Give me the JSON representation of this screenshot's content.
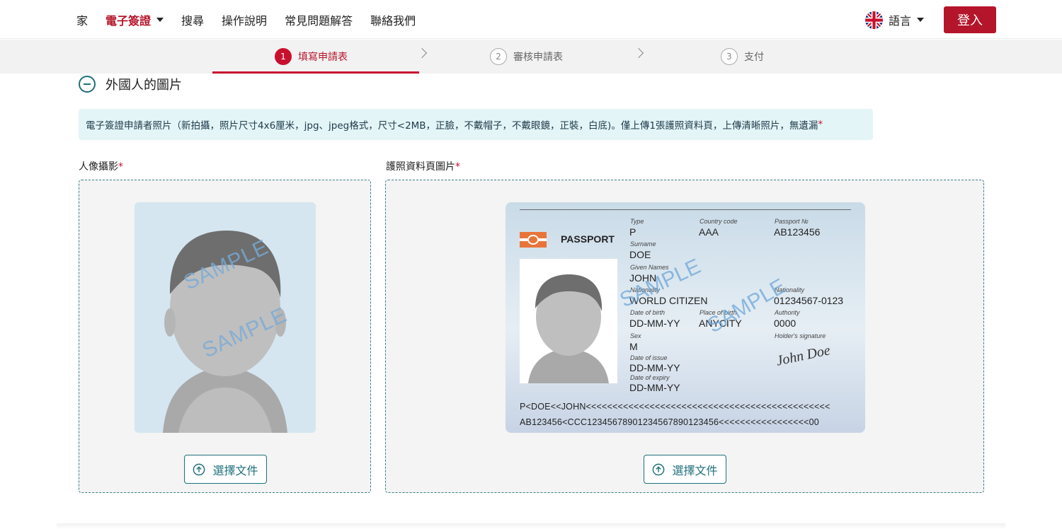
{
  "nav": {
    "items": [
      {
        "label": "家"
      },
      {
        "label": "電子簽證"
      },
      {
        "label": "搜尋"
      },
      {
        "label": "操作說明"
      },
      {
        "label": "常見問題解答"
      },
      {
        "label": "聯絡我們"
      }
    ],
    "language_label": "語言",
    "login_label": "登入"
  },
  "steps": [
    {
      "num": "1",
      "label": "填寫申請表"
    },
    {
      "num": "2",
      "label": "審核申請表"
    },
    {
      "num": "3",
      "label": "支付"
    }
  ],
  "section": {
    "title": "外國人的圖片",
    "notice": "電子簽證申請者照片（新拍攝，照片尺寸4x6厘米，jpg、jpeg格式，尺寸<2MB，正臉，不戴帽子，不戴眼鏡，正裝，白底)。僅上傳1張護照資料頁，上傳清晰照片，無遺漏",
    "required_mark": "*"
  },
  "portrait": {
    "label": "人像攝影",
    "required_mark": "*",
    "sample_text": "SAMPLE",
    "button_label": "選擇文件"
  },
  "passport_upload": {
    "label": "護照資料頁圖片",
    "required_mark": "*",
    "button_label": "選擇文件",
    "sample_text": "SAMPLE",
    "card": {
      "title": "PASSPORT",
      "type_label": "Type",
      "type_value": "P",
      "country_label": "Country code",
      "country_value": "AAA",
      "passport_no_label": "Passport №",
      "passport_no_value": "AB123456",
      "surname_label": "Surname",
      "surname_value": "DOE",
      "given_label": "Given Names",
      "given_value": "JOHN",
      "nationality_label": "Nationality",
      "nationality_value": "WORLD CITIZEN",
      "personal_label": "Nationality",
      "personal_value": "01234567-0123",
      "dob_label": "Date of birth",
      "dob_value": "DD-MM-YY",
      "pob_label": "Place of birth",
      "pob_value": "ANYCITY",
      "authority_label": "Authority",
      "authority_value": "0000",
      "sex_label": "Sex",
      "sex_value": "M",
      "signature_label": "Holder's signature",
      "signature_value": "John Doe",
      "issue_label": "Date of issue",
      "issue_value": "DD-MM-YY",
      "expiry_label": "Date of expiry",
      "expiry_value": "DD-MM-YY",
      "mrz1": "P<DOE<<JOHN<<<<<<<<<<<<<<<<<<<<<<<<<<<<<<<<<<<<<<<<<<<<<<",
      "mrz2": "AB123456<CCC12345678901234567890123456<<<<<<<<<<<<<<<<<00"
    }
  },
  "colors": {
    "brand_red": "#b5152b",
    "teal": "#1d6f7a",
    "notice_bg": "#e3f5f7"
  }
}
